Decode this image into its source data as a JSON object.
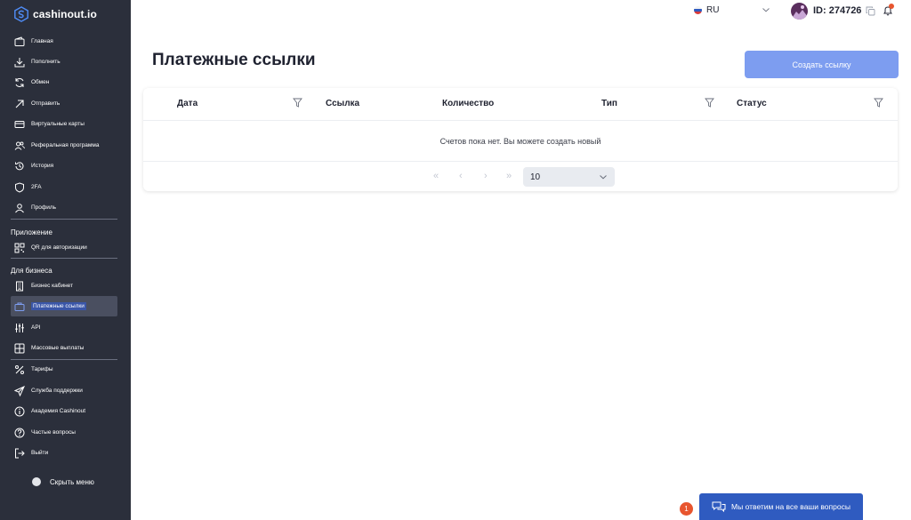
{
  "brand": {
    "name": "cashinout.io"
  },
  "sidebar": {
    "items": [
      {
        "label": "Главная",
        "icon": "wallet-icon"
      },
      {
        "label": "Пополнить",
        "icon": "download-icon"
      },
      {
        "label": "Обмен",
        "icon": "exchange-icon"
      },
      {
        "label": "Отправить",
        "icon": "send-arrow-icon"
      },
      {
        "label": "Виртуальные карты",
        "icon": "card-icon"
      },
      {
        "label": "Реферальная программа",
        "icon": "users-icon"
      },
      {
        "label": "История",
        "icon": "history-icon"
      },
      {
        "label": "2FA",
        "icon": "shield-icon"
      },
      {
        "label": "Профиль",
        "icon": "user-icon"
      }
    ],
    "app_section": {
      "label": "Приложение",
      "items": [
        {
          "label": "QR для авторизации",
          "icon": "qr-icon"
        }
      ]
    },
    "business_section": {
      "label": "Для бизнеса",
      "items": [
        {
          "label": "Бизнес кабинет",
          "icon": "building-icon"
        },
        {
          "label": "Платежные ссылки",
          "icon": "briefcase-icon",
          "active": true
        },
        {
          "label": "API",
          "icon": "sliders-icon"
        },
        {
          "label": "Массовые выплаты",
          "icon": "grid-icon"
        }
      ]
    },
    "bottom_items": [
      {
        "label": "Тарифы",
        "icon": "percent-icon"
      },
      {
        "label": "Служба поддержки",
        "icon": "paper-plane-icon"
      },
      {
        "label": "Академия Cashinout",
        "icon": "info-icon"
      },
      {
        "label": "Частые вопросы",
        "icon": "question-icon"
      },
      {
        "label": "Выйти",
        "icon": "logout-icon"
      }
    ],
    "hide_menu": "Скрыть меню"
  },
  "header": {
    "language": "RU",
    "user_id": "ID: 274726"
  },
  "main": {
    "title": "Платежные ссылки",
    "create_button": "Создать ссылку",
    "table": {
      "columns": [
        "Дата",
        "Ссылка",
        "Количество",
        "Тип",
        "Статус"
      ],
      "empty_text": "Счетов пока нет. Вы можете создать новый",
      "per_page": "10"
    }
  },
  "chat": {
    "badge": "1",
    "label": "Мы ответим на все ваши вопросы"
  },
  "colors": {
    "sidebar_bg": "#2b2f3b",
    "primary_button": "#7d9df0",
    "chat_button": "#2f5bc0",
    "badge": "#e8552e"
  }
}
